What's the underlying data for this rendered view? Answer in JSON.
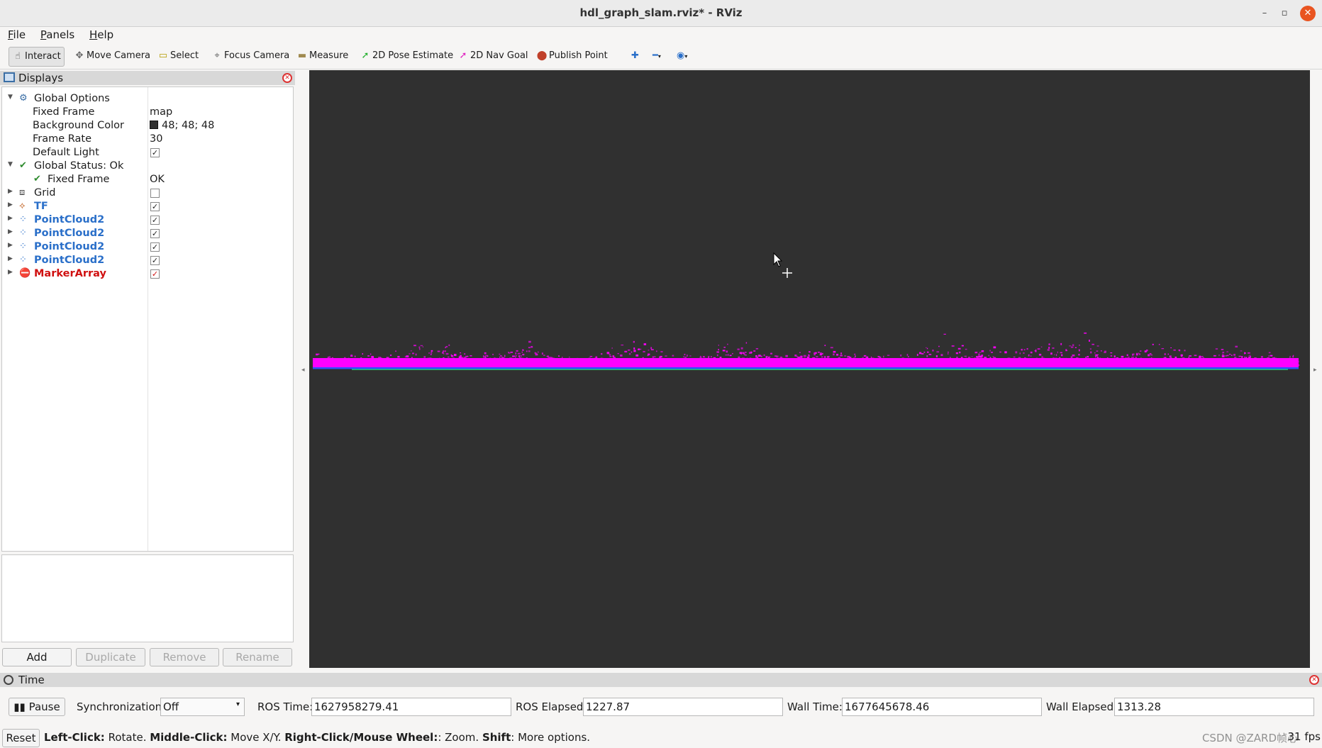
{
  "window": {
    "title": "hdl_graph_slam.rviz* - RViz"
  },
  "menu": [
    "File",
    "Panels",
    "Help"
  ],
  "toolbar": [
    {
      "label": "Interact",
      "icon": "hand-icon",
      "glyph": "☝",
      "color": "#444"
    },
    {
      "label": "Move Camera",
      "icon": "move-camera-icon",
      "glyph": "✥",
      "color": "#666"
    },
    {
      "label": "Select",
      "icon": "select-box-icon",
      "glyph": "▭",
      "color": "#b59b00"
    },
    {
      "label": "Focus Camera",
      "icon": "focus-camera-icon",
      "glyph": "⌖",
      "color": "#666"
    },
    {
      "label": "Measure",
      "icon": "ruler-icon",
      "glyph": "▬",
      "color": "#a08a50"
    },
    {
      "label": "2D Pose Estimate",
      "icon": "pose-arrow-icon",
      "glyph": "➚",
      "color": "#1fae2a"
    },
    {
      "label": "2D Nav Goal",
      "icon": "nav-goal-arrow-icon",
      "glyph": "➚",
      "color": "#e020c0"
    },
    {
      "label": "Publish Point",
      "icon": "map-pin-icon",
      "glyph": "⬤",
      "color": "#c0402a"
    }
  ],
  "displays": {
    "title": "Displays",
    "rows": [
      {
        "label": "Global Options",
        "icon": "gear-icon",
        "glyph": "⚙",
        "iconColor": "#3a6ea5",
        "expanded": true
      },
      {
        "label": "Fixed Frame",
        "value": "map"
      },
      {
        "label": "Background Color",
        "value": "48; 48; 48",
        "swatch": "#303030"
      },
      {
        "label": "Frame Rate",
        "value": "30"
      },
      {
        "label": "Default Light",
        "checked": true
      },
      {
        "label": "Global Status: Ok",
        "icon": "check-icon",
        "glyph": "✔",
        "iconColor": "#2e8b2e",
        "expanded": true
      },
      {
        "label": "Fixed Frame",
        "value": "OK",
        "icon": "check-icon",
        "glyph": "✔",
        "iconColor": "#2e8b2e",
        "indent": true
      },
      {
        "label": "Grid",
        "icon": "grid-icon",
        "glyph": "⧈",
        "iconColor": "#444",
        "checked": false
      },
      {
        "label": "TF",
        "icon": "tf-axes-icon",
        "glyph": "⟡",
        "iconColor": "#c06020",
        "checked": true,
        "style": "blue"
      },
      {
        "label": "PointCloud2",
        "icon": "pointcloud-icon",
        "glyph": "⁘",
        "iconColor": "#2a6fc9",
        "checked": true,
        "style": "blue"
      },
      {
        "label": "PointCloud2",
        "icon": "pointcloud-icon",
        "glyph": "⁘",
        "iconColor": "#2a6fc9",
        "checked": true,
        "style": "blue"
      },
      {
        "label": "PointCloud2",
        "icon": "pointcloud-icon",
        "glyph": "⁘",
        "iconColor": "#2a6fc9",
        "checked": true,
        "style": "blue"
      },
      {
        "label": "PointCloud2",
        "icon": "pointcloud-icon",
        "glyph": "⁘",
        "iconColor": "#2a6fc9",
        "checked": true,
        "style": "blue"
      },
      {
        "label": "MarkerArray",
        "icon": "error-icon",
        "glyph": "⛔",
        "iconColor": "#d01010",
        "checked": true,
        "style": "red"
      }
    ],
    "buttons": {
      "add": "Add",
      "duplicate": "Duplicate",
      "remove": "Remove",
      "rename": "Rename"
    }
  },
  "time": {
    "title": "Time",
    "pause": "Pause",
    "sync_label": "Synchronization:",
    "sync_value": "Off",
    "ros_time_label": "ROS Time:",
    "ros_time": "1627958279.41",
    "ros_elapsed_label": "ROS Elapsed:",
    "ros_elapsed": "1227.87",
    "wall_time_label": "Wall Time:",
    "wall_time": "1677645678.46",
    "wall_elapsed_label": "Wall Elapsed:",
    "wall_elapsed": "1313.28"
  },
  "status": {
    "reset": "Reset",
    "k1": "Left-Click:",
    "v1": " Rotate. ",
    "k2": "Middle-Click:",
    "v2": " Move X/Y. ",
    "k3": "Right-Click/Mouse Wheel:",
    "v3": ": Zoom. ",
    "k4": "Shift",
    "v4": ": More options.",
    "fps": "31 fps",
    "watermark": "CSDN @ZARD帧心"
  },
  "colors": {
    "viewport_bg": "#303030",
    "cloud": "#ff00ff"
  }
}
